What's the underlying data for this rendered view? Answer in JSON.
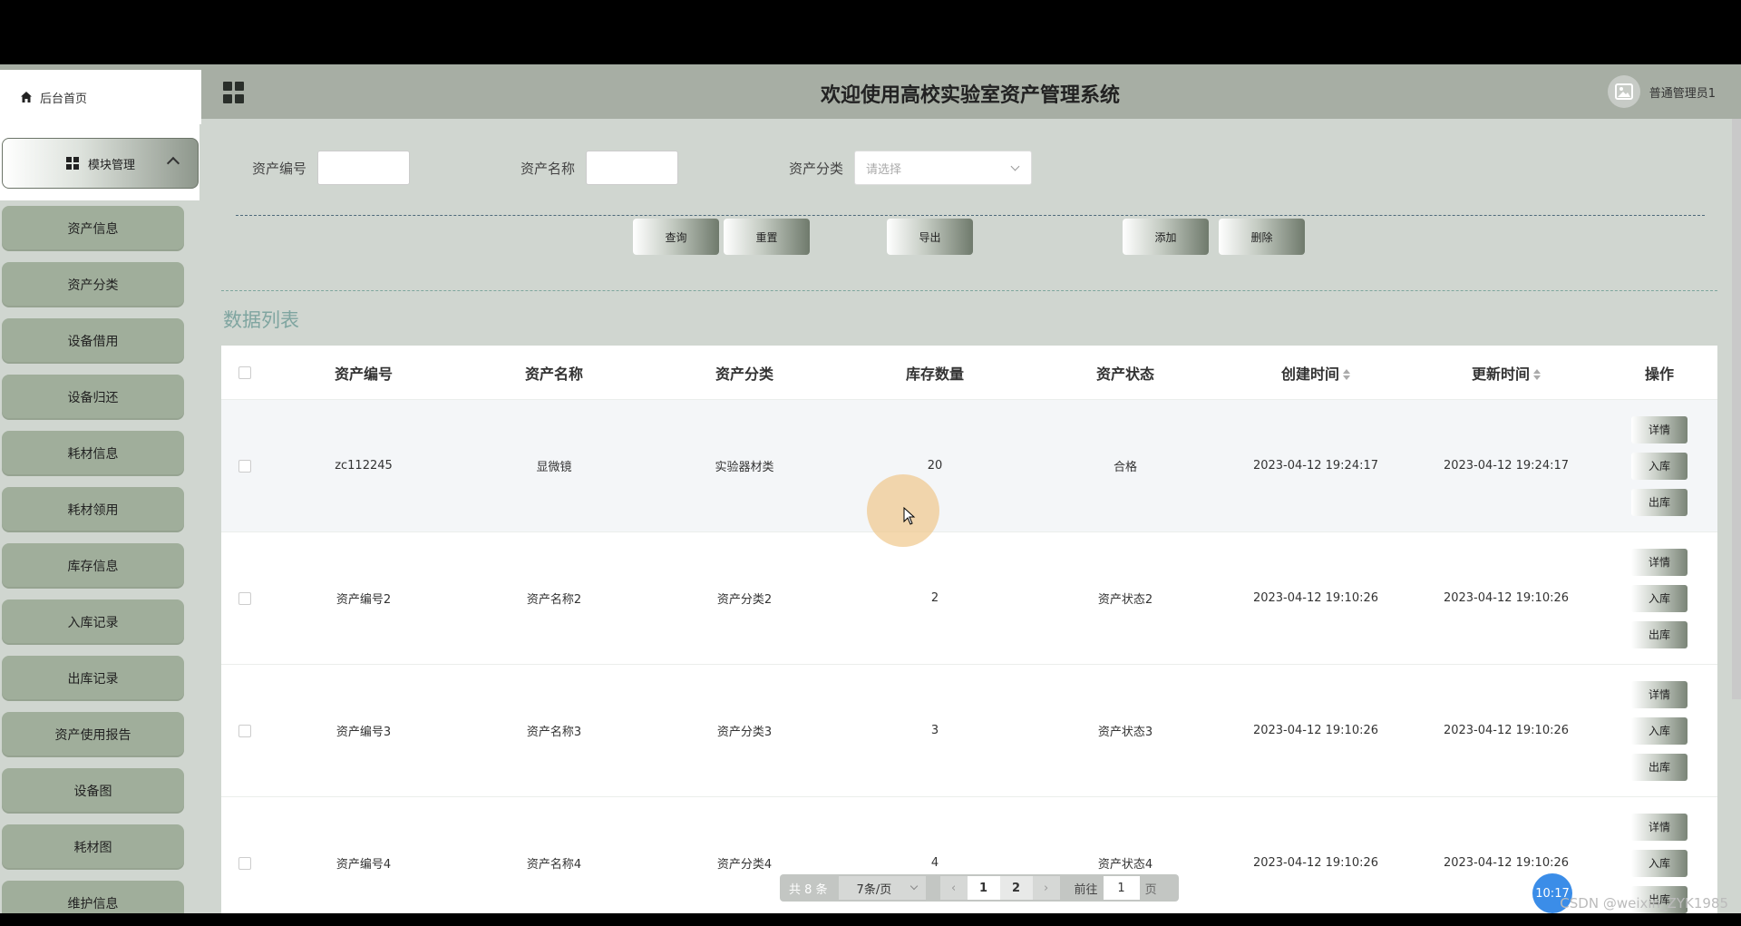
{
  "header": {
    "home_label": "后台首页",
    "title": "欢迎使用高校实验室资产管理系统",
    "user_label": "普通管理员1"
  },
  "sidebar": {
    "module_label": "模块管理",
    "items": [
      {
        "label": "资产信息"
      },
      {
        "label": "资产分类"
      },
      {
        "label": "设备借用"
      },
      {
        "label": "设备归还"
      },
      {
        "label": "耗材信息"
      },
      {
        "label": "耗材领用"
      },
      {
        "label": "库存信息"
      },
      {
        "label": "入库记录"
      },
      {
        "label": "出库记录"
      },
      {
        "label": "资产使用报告"
      },
      {
        "label": "设备图"
      },
      {
        "label": "耗材图"
      },
      {
        "label": "维护信息"
      }
    ]
  },
  "search": {
    "asset_no_label": "资产编号",
    "asset_name_label": "资产名称",
    "category_label": "资产分类",
    "category_placeholder": "请选择"
  },
  "buttons": {
    "query": "查询",
    "reset": "重置",
    "export": "导出",
    "add": "添加",
    "delete": "删除"
  },
  "list_title": "数据列表",
  "table": {
    "headers": [
      "资产编号",
      "资产名称",
      "资产分类",
      "库存数量",
      "资产状态",
      "创建时间",
      "更新时间",
      "操作"
    ],
    "rows": [
      {
        "asset_no": "zc112245",
        "name": "显微镜",
        "category": "实验器材类",
        "qty": "20",
        "status": "合格",
        "created": "2023-04-12 19:24:17",
        "updated": "2023-04-12 19:24:17"
      },
      {
        "asset_no": "资产编号2",
        "name": "资产名称2",
        "category": "资产分类2",
        "qty": "2",
        "status": "资产状态2",
        "created": "2023-04-12 19:10:26",
        "updated": "2023-04-12 19:10:26"
      },
      {
        "asset_no": "资产编号3",
        "name": "资产名称3",
        "category": "资产分类3",
        "qty": "3",
        "status": "资产状态3",
        "created": "2023-04-12 19:10:26",
        "updated": "2023-04-12 19:10:26"
      },
      {
        "asset_no": "资产编号4",
        "name": "资产名称4",
        "category": "资产分类4",
        "qty": "4",
        "status": "资产状态4",
        "created": "2023-04-12 19:10:26",
        "updated": "2023-04-12 19:10:26"
      }
    ],
    "ops": {
      "detail": "详情",
      "in": "入库",
      "out": "出库"
    }
  },
  "pager": {
    "total": "共 8 条",
    "size": "7条/页",
    "pages": [
      "1",
      "2"
    ],
    "goto_label": "前往",
    "goto_value": "1",
    "page_suffix": "页"
  },
  "overlay": {
    "clock": "10:17",
    "watermark": "CSDN @weixin_ZYK1985"
  },
  "colors": {
    "header_bg": "#a7aea4",
    "sidebar_item_bg": "#a0ae9b",
    "content_bg": "#d0d6d0",
    "list_title": "#7fa5a0"
  }
}
